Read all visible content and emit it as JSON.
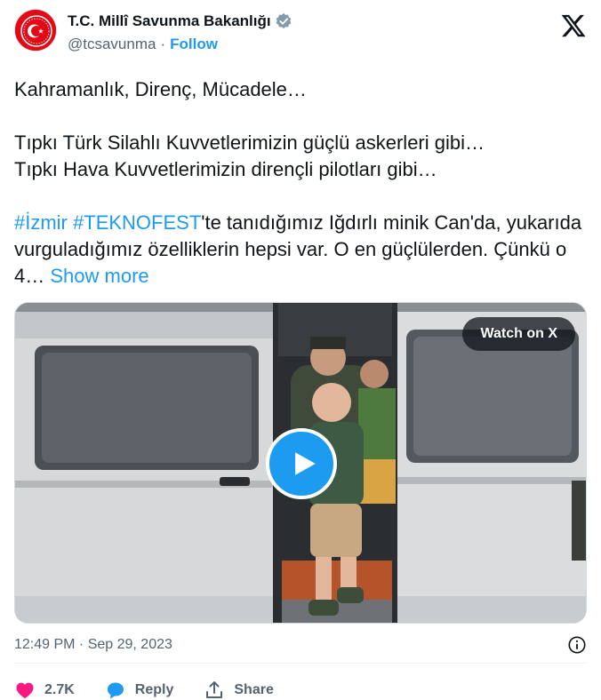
{
  "account": {
    "display_name": "T.C. Millî Savunma Bakanlığı",
    "handle": "@tcsavunma",
    "separator": "·",
    "follow_label": "Follow",
    "brand_color": "#e30a17",
    "accent_color": "#1d9bf0"
  },
  "tweet": {
    "line1": "Kahramanlık, Direnç, Mücadele…",
    "line2": "Tıpkı Türk Silahlı Kuvvetlerimizin güçlü askerleri gibi…",
    "line3": "Tıpkı Hava Kuvvetlerimizin dirençli pilotları gibi…",
    "hashtag1": "#İzmir",
    "hashtag2": "#TEKNOFEST",
    "para3_rest": "'te tanıdığımız Iğdırlı minik Can'da, yukarıda vurguladığımız özelliklerin hepsi var. O en güçlülerden. Çünkü o 4…",
    "show_more": "Show more"
  },
  "media": {
    "watch_label": "Watch on X",
    "play_icon": "play-icon"
  },
  "meta": {
    "timestamp": "12:49 PM · Sep 29, 2023",
    "info_icon": "info-icon"
  },
  "actions": {
    "like_count": "2.7K",
    "reply_label": "Reply",
    "share_label": "Share",
    "like_color": "#f91880"
  }
}
